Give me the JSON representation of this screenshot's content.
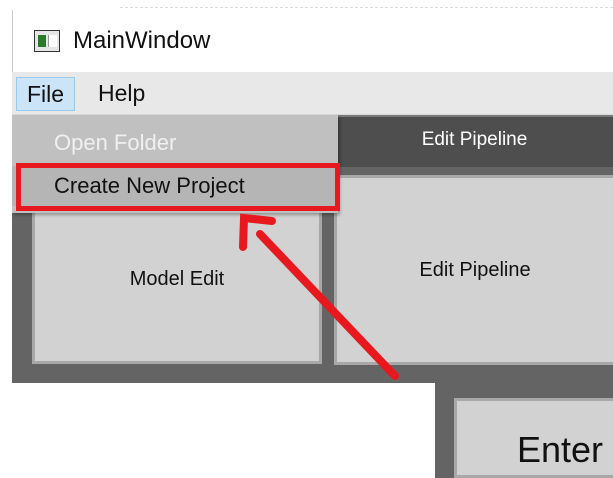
{
  "window": {
    "title": "MainWindow",
    "icon": "app-window-icon"
  },
  "menubar": {
    "file": "File",
    "help": "Help"
  },
  "file_menu": {
    "items": [
      {
        "label": "Open Folder",
        "state": "disabled"
      },
      {
        "label": "Create New Project",
        "state": "hover"
      }
    ]
  },
  "tabs": [
    {
      "label": "Edit Pipeline"
    }
  ],
  "buttons": {
    "model_edit": "Model Edit",
    "edit_pipeline": "Edit Pipeline",
    "enter": "Enter"
  },
  "annotation": {
    "highlight_color": "#e8181f",
    "target": "Create New Project"
  },
  "colors": {
    "menu_highlight": "#cce4f7",
    "dark_panel": "#646464",
    "tab_bg": "#4e4e4e",
    "button_bg": "#d2d2d2"
  }
}
